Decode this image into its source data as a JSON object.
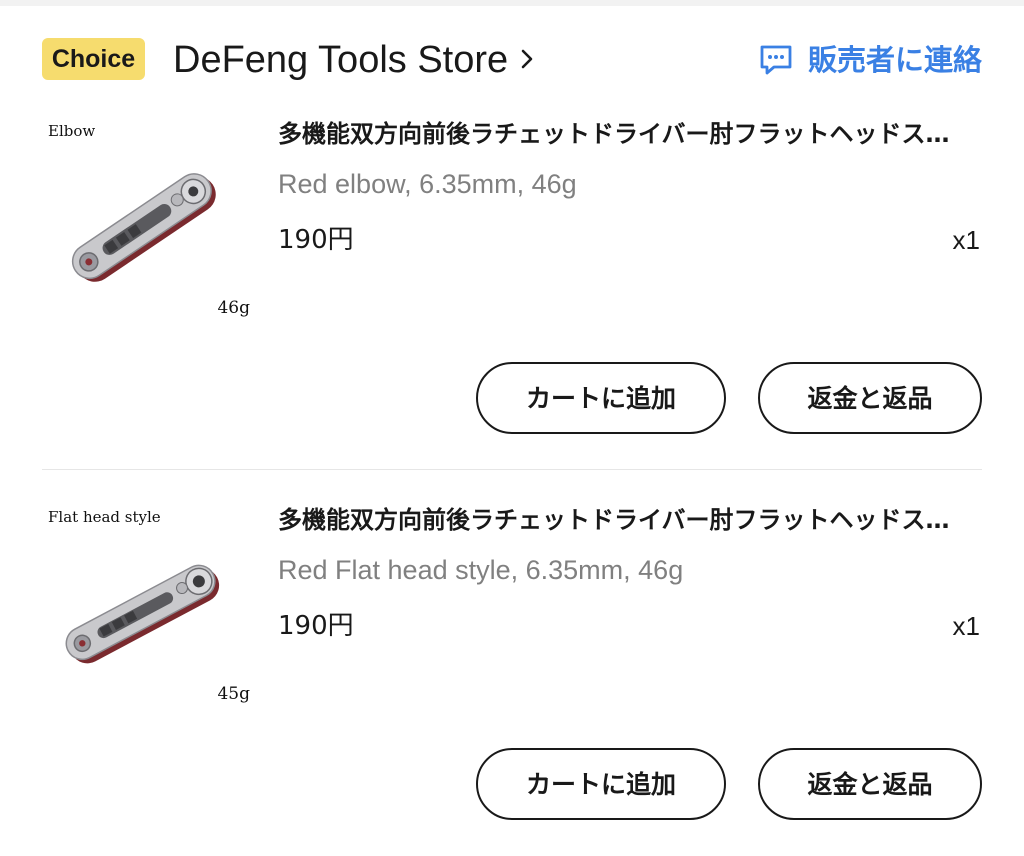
{
  "store": {
    "badge": "Choice",
    "name": "DeFeng Tools Store",
    "contact_label": "販売者に連絡",
    "accent_color": "#3a80e4",
    "badge_color": "#f6dc6e"
  },
  "items": [
    {
      "thumb_caption": "Elbow",
      "thumb_weight": "46g",
      "title": "多機能双方向前後ラチェットドライバー肘フラットヘッドスタイル",
      "variant": "Red elbow, 6.35mm, 46g",
      "price": "190円",
      "quantity": "x1",
      "add_to_cart_label": "カートに追加",
      "refund_label": "返金と返品"
    },
    {
      "thumb_caption": "Flat head style",
      "thumb_weight": "45g",
      "title": "多機能双方向前後ラチェットドライバー肘フラットヘッドスタイル",
      "variant": "Red Flat head style, 6.35mm, 46g",
      "price": "190円",
      "quantity": "x1",
      "add_to_cart_label": "カートに追加",
      "refund_label": "返金と返品"
    }
  ]
}
